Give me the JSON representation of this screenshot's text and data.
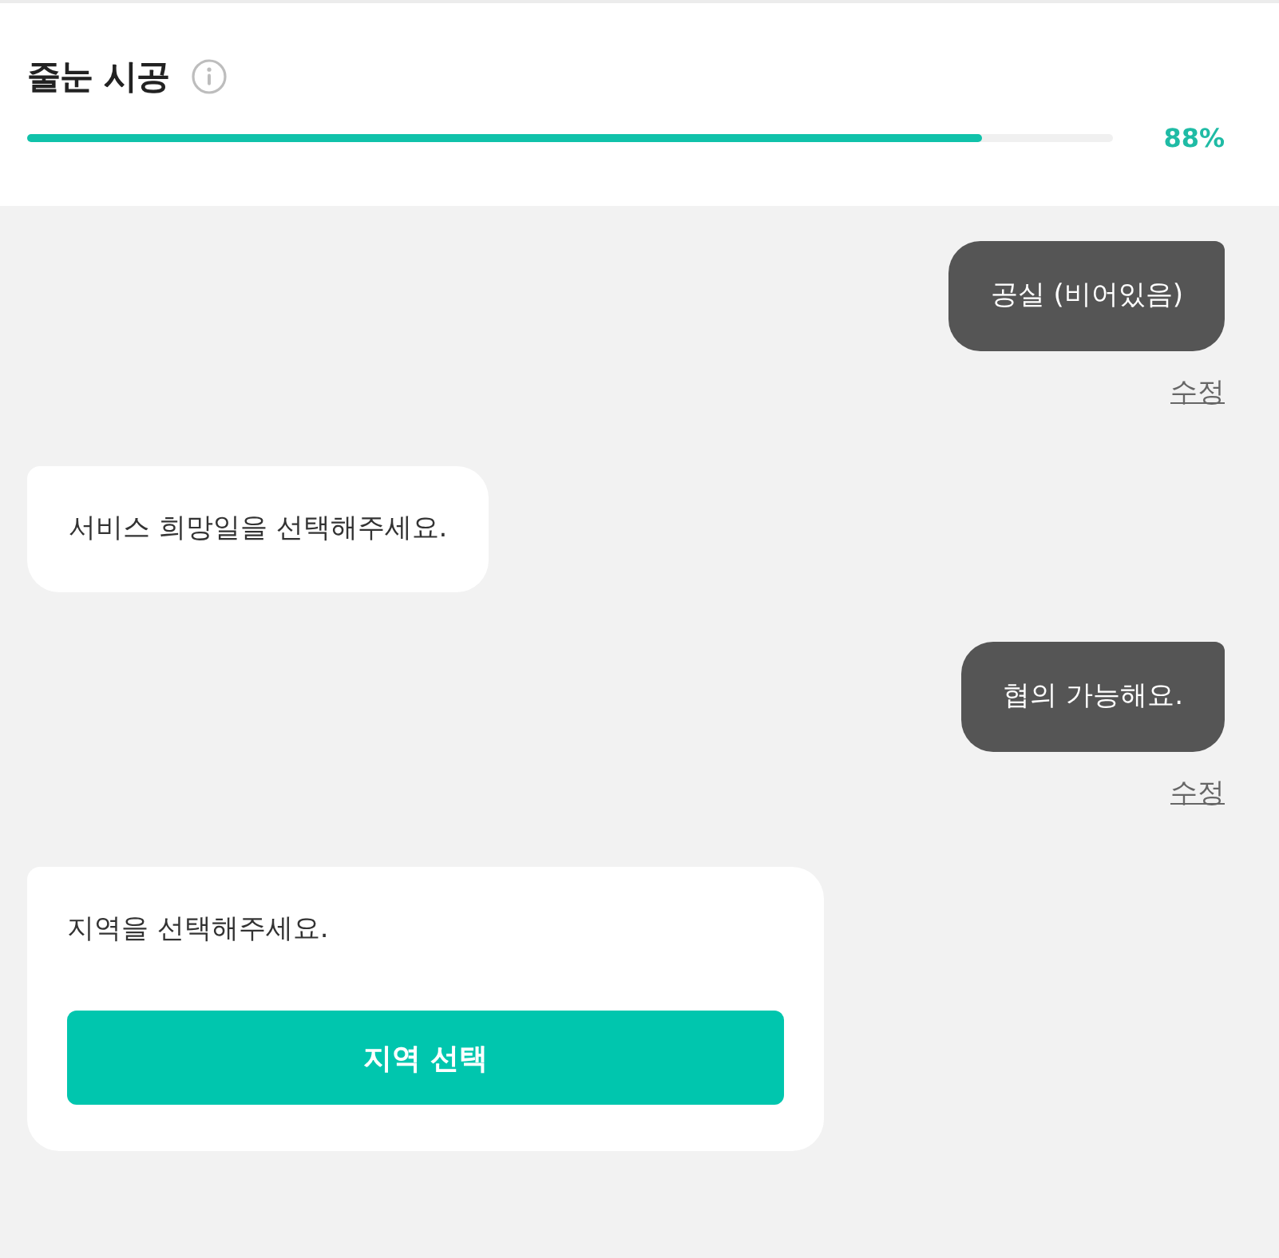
{
  "header": {
    "title": "줄눈 시공",
    "progress": {
      "level": 0.88,
      "reading": "88%"
    }
  },
  "messages": [
    {
      "kind": "answer",
      "text": "공실 (비어있음)",
      "edit_link": "수정"
    },
    {
      "kind": "question",
      "text": "서비스 희망일을 선택해주세요."
    },
    {
      "kind": "answer",
      "text": "협의 가능해요.",
      "edit_link": "수정"
    },
    {
      "kind": "question",
      "text": "지역을 선택해주세요.",
      "button": "지역 선택"
    }
  ]
}
